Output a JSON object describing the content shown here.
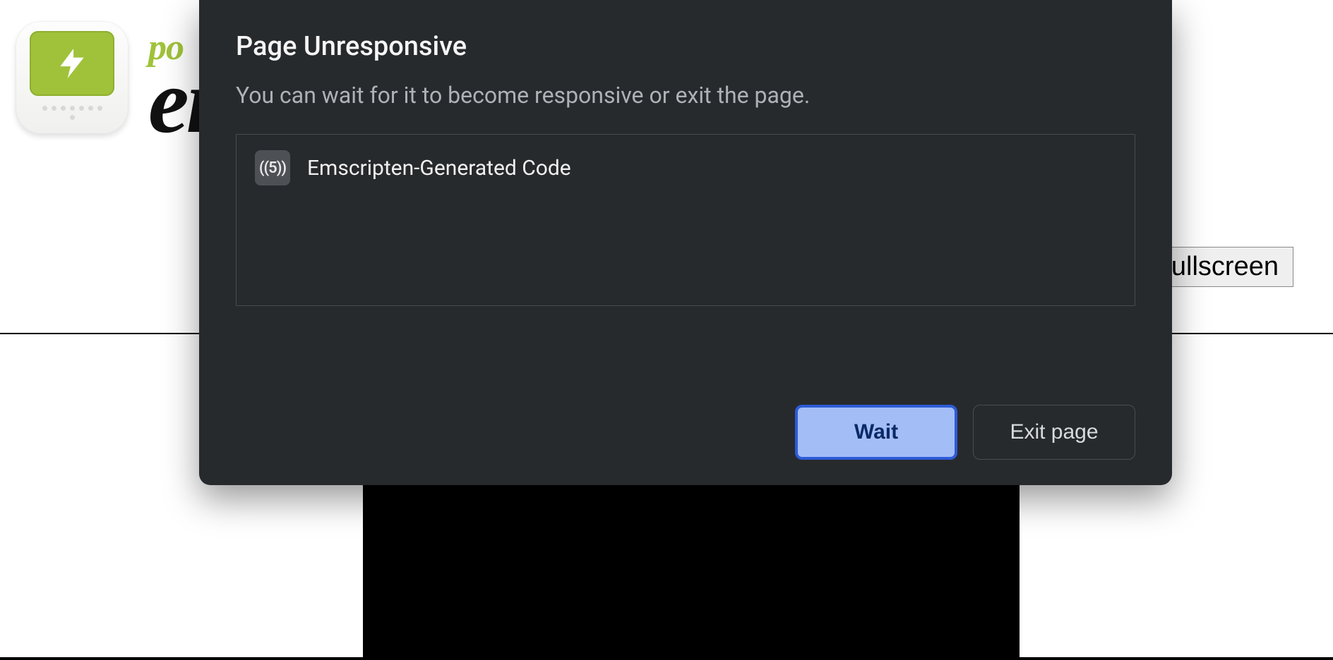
{
  "background": {
    "wordmark_top": "po",
    "wordmark_bottom": "en",
    "fullscreen_label": "Fullscreen"
  },
  "dialog": {
    "title": "Page Unresponsive",
    "description": "You can wait for it to become responsive or exit the page.",
    "process_name": "Emscripten-Generated Code",
    "process_icon_text": "((5))",
    "wait_label": "Wait",
    "exit_label": "Exit page"
  }
}
